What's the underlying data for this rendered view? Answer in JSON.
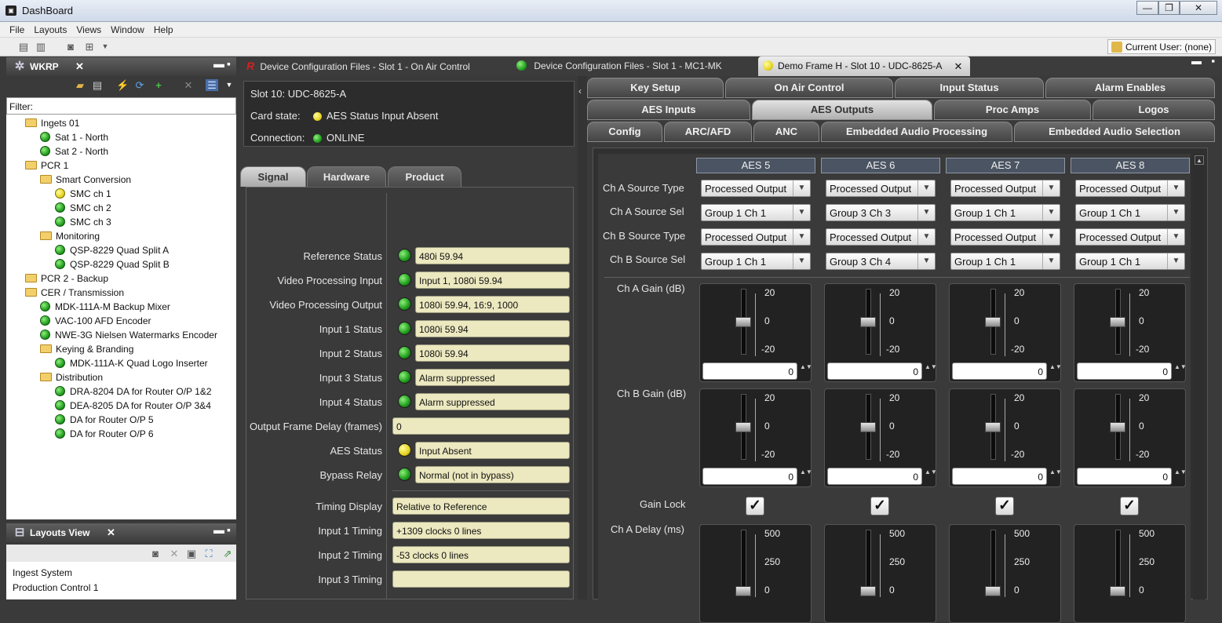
{
  "window": {
    "title": "DashBoard",
    "min": "—",
    "max": "❐",
    "close": "✕"
  },
  "menu": [
    "File",
    "Layouts",
    "Views",
    "Window",
    "Help"
  ],
  "current_user": "Current User: (none)",
  "wkrp_panel": {
    "title": "WKRP",
    "filter_label": "Filter:"
  },
  "tree": [
    {
      "label": "Ingets 01",
      "kind": "folder",
      "indent": 0
    },
    {
      "label": "Sat 1 - North",
      "kind": "green",
      "indent": 1
    },
    {
      "label": "Sat 2 - North",
      "kind": "green",
      "indent": 1
    },
    {
      "label": "PCR 1",
      "kind": "folder",
      "indent": 0
    },
    {
      "label": "Smart Conversion",
      "kind": "folder",
      "indent": 1
    },
    {
      "label": "SMC ch 1",
      "kind": "yellow",
      "indent": 2
    },
    {
      "label": "SMC ch 2",
      "kind": "green",
      "indent": 2
    },
    {
      "label": "SMC ch 3",
      "kind": "green",
      "indent": 2
    },
    {
      "label": "Monitoring",
      "kind": "folder",
      "indent": 1
    },
    {
      "label": "QSP-8229 Quad Split A",
      "kind": "green",
      "indent": 2
    },
    {
      "label": "QSP-8229 Quad Split B",
      "kind": "green",
      "indent": 2
    },
    {
      "label": "PCR 2 - Backup",
      "kind": "folder",
      "indent": 0
    },
    {
      "label": "CER / Transmission",
      "kind": "folder",
      "indent": 0
    },
    {
      "label": "MDK-111A-M Backup Mixer",
      "kind": "green",
      "indent": 1
    },
    {
      "label": "VAC-100 AFD Encoder",
      "kind": "green",
      "indent": 1
    },
    {
      "label": "NWE-3G Nielsen Watermarks Encoder",
      "kind": "green",
      "indent": 1
    },
    {
      "label": "Keying & Branding",
      "kind": "folder",
      "indent": 1
    },
    {
      "label": "MDK-111A-K Quad Logo Inserter",
      "kind": "green",
      "indent": 2
    },
    {
      "label": "Distribution",
      "kind": "folder",
      "indent": 1
    },
    {
      "label": "DRA-8204 DA for Router O/P 1&2",
      "kind": "green",
      "indent": 2
    },
    {
      "label": "DEA-8205 DA for Router O/P 3&4",
      "kind": "green",
      "indent": 2
    },
    {
      "label": "DA for Router O/P 5",
      "kind": "green",
      "indent": 2
    },
    {
      "label": "DA for Router O/P 6",
      "kind": "green",
      "indent": 2
    }
  ],
  "layouts_panel": {
    "title": "Layouts View",
    "items": [
      "Ingest System",
      "Production Control 1"
    ]
  },
  "doc_tabs": [
    {
      "label": "Device Configuration Files - Slot 1 - On Air Control",
      "icon": "r-logo-icon"
    },
    {
      "label": "Device Configuration Files - Slot 1 - MC1-MK",
      "icon": "green-status-icon"
    },
    {
      "label": "Demo Frame H - Slot 10 - UDC-8625-A",
      "icon": "yellow-status-icon"
    }
  ],
  "card": {
    "slot": "Slot 10: UDC-8625-A",
    "state_label": "Card state:",
    "state_value": "AES Status Input Absent",
    "conn_label": "Connection:",
    "conn_value": "ONLINE"
  },
  "section_tabs": [
    "Signal",
    "Hardware",
    "Product"
  ],
  "signal_rows": [
    {
      "label": "Reference Status",
      "value": "480i 59.94",
      "led": "green"
    },
    {
      "label": "Video Processing Input",
      "value": "Input 1, 1080i 59.94",
      "led": "green"
    },
    {
      "label": "Video Processing Output",
      "value": "1080i 59.94, 16:9, 1000",
      "led": "green"
    },
    {
      "label": "Input 1 Status",
      "value": "1080i 59.94",
      "led": "green"
    },
    {
      "label": "Input 2 Status",
      "value": "1080i 59.94",
      "led": "green"
    },
    {
      "label": "Input 3 Status",
      "value": "Alarm suppressed",
      "led": "green"
    },
    {
      "label": "Input 4 Status",
      "value": "Alarm suppressed",
      "led": "green"
    },
    {
      "label": "Output Frame Delay (frames)",
      "value": "0",
      "led": "none"
    },
    {
      "label": "AES Status",
      "value": "Input Absent",
      "led": "yellow"
    },
    {
      "label": "Bypass Relay",
      "value": "Normal (not in bypass)",
      "led": "green"
    },
    {
      "label": "Timing Display",
      "value": "Relative to Reference",
      "led": "none"
    },
    {
      "label": "Input 1 Timing",
      "value": "+1309 clocks 0 lines",
      "led": "none"
    },
    {
      "label": "Input 2 Timing",
      "value": "-53 clocks 0 lines",
      "led": "none"
    },
    {
      "label": "Input 3 Timing",
      "value": "",
      "led": "none"
    }
  ],
  "right_tabs": {
    "row1": [
      "Key Setup",
      "On Air Control",
      "Input Status",
      "Alarm Enables"
    ],
    "row2": [
      "AES Inputs",
      "AES Outputs",
      "Proc Amps",
      "Logos"
    ],
    "row3": [
      "Config",
      "ARC/AFD",
      "ANC",
      "Embedded Audio Processing",
      "Embedded Audio Selection"
    ],
    "active": "AES Outputs"
  },
  "aes": {
    "columns": [
      "AES 5",
      "AES 6",
      "AES 7",
      "AES 8"
    ],
    "row_labels": {
      "a_type": "Ch A Source Type",
      "a_sel": "Ch A Source Sel",
      "b_type": "Ch B Source Type",
      "b_sel": "Ch B Source Sel",
      "a_gain": "Ch A Gain (dB)",
      "b_gain": "Ch B Gain (dB)",
      "gain_lock": "Gain Lock",
      "a_delay": "Ch A Delay (ms)"
    },
    "a_type": [
      "Processed Output",
      "Processed Output",
      "Processed Output",
      "Processed Output"
    ],
    "a_sel": [
      "Group 1 Ch 1",
      "Group 3 Ch 3",
      "Group 1 Ch 1",
      "Group 1 Ch 1"
    ],
    "b_type": [
      "Processed Output",
      "Processed Output",
      "Processed Output",
      "Processed Output"
    ],
    "b_sel": [
      "Group 1 Ch 1",
      "Group 3 Ch 4",
      "Group 1 Ch 1",
      "Group 1 Ch 1"
    ],
    "gain_ticks": [
      "20",
      "0",
      "-20"
    ],
    "gain_a": [
      "0",
      "0",
      "0",
      "0"
    ],
    "gain_b": [
      "0",
      "0",
      "0",
      "0"
    ],
    "gain_lock": [
      true,
      true,
      true,
      true
    ],
    "delay_ticks": [
      "500",
      "250",
      "0"
    ]
  }
}
